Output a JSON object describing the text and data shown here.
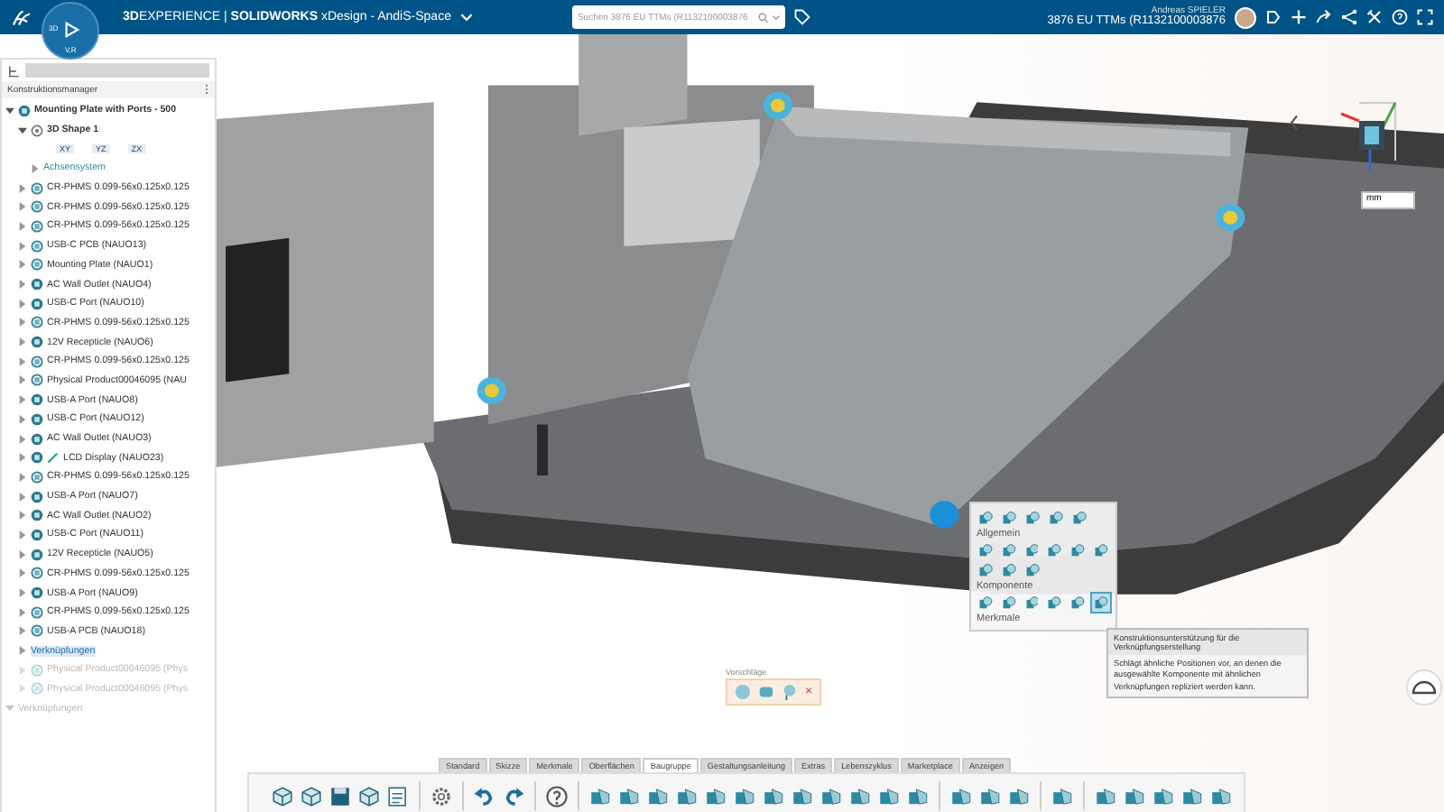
{
  "header": {
    "compass_labels": [
      "3D",
      "V,R"
    ],
    "title": "**3D**EXPERIENCE | **SOLIDWORKS** xDesign - AndiS-Space",
    "search": {
      "placeholder": "Suchen 3876 EU TTMs (R1132100003876"
    },
    "user": "Andreas SPIELER",
    "document": "3876 EU TTMs (R1132100003876"
  },
  "tree": {
    "title": "Konstruktionsmanager",
    "items": [
      {
        "label": "Mounting Plate with Ports - 500",
        "kind": "assembly",
        "expanded": true,
        "disabled": false,
        "children": [
          {
            "label": "3D Shape 1",
            "kind": "shape",
            "expanded": true,
            "disabled": false,
            "children": [
              {
                "kind": "planes",
                "planes": [
                  "XY",
                  "YZ",
                  "ZX"
                ]
              },
              {
                "label": "Achsensystem",
                "kind": "axis",
                "expanded": false,
                "disabled": false
              }
            ]
          },
          {
            "label": "CR-PHMS 0.099-56x0.125x0.125",
            "kind": "part",
            "expanded": false,
            "disabled": false
          },
          {
            "label": "CR-PHMS 0.099-56x0.125x0.125",
            "kind": "part",
            "expanded": false,
            "disabled": false
          },
          {
            "label": "CR-PHMS 0.099-56x0.125x0.125",
            "kind": "part",
            "expanded": false,
            "disabled": false
          },
          {
            "label": "USB-C PCB (NAUO13)",
            "kind": "part",
            "expanded": false,
            "disabled": false
          },
          {
            "label": "Mounting Plate (NAUO1)",
            "kind": "part",
            "expanded": false,
            "disabled": false
          },
          {
            "label": "AC Wall Outlet (NAUO4)",
            "kind": "product",
            "expanded": false,
            "disabled": false
          },
          {
            "label": "USB-C Port (NAUO10)",
            "kind": "product",
            "expanded": false,
            "disabled": false
          },
          {
            "label": "CR-PHMS 0.099-56x0.125x0.125",
            "kind": "part",
            "expanded": false,
            "disabled": false
          },
          {
            "label": "12V Recepticle (NAUO6)",
            "kind": "product",
            "expanded": false,
            "disabled": false
          },
          {
            "label": "CR-PHMS 0.099-56x0.125x0.125",
            "kind": "part",
            "expanded": false,
            "disabled": false
          },
          {
            "label": "Physical Product00046095 (NAU",
            "kind": "part",
            "expanded": false,
            "disabled": false
          },
          {
            "label": "USB-A Port (NAUO8)",
            "kind": "product",
            "expanded": false,
            "disabled": false
          },
          {
            "label": "USB-C Port (NAUO12)",
            "kind": "product",
            "expanded": false,
            "disabled": false
          },
          {
            "label": "AC Wall Outlet (NAUO3)",
            "kind": "product",
            "expanded": false,
            "disabled": false
          },
          {
            "label": "LCD Display (NAUO23)",
            "kind": "edited",
            "expanded": false,
            "disabled": false
          },
          {
            "label": "CR-PHMS 0.099-56x0.125x0.125",
            "kind": "part",
            "expanded": false,
            "disabled": false
          },
          {
            "label": "USB-A Port (NAUO7)",
            "kind": "product",
            "expanded": false,
            "disabled": false
          },
          {
            "label": "AC Wall Outlet (NAUO2)",
            "kind": "product",
            "expanded": false,
            "disabled": false
          },
          {
            "label": "USB-C Port (NAUO11)",
            "kind": "product",
            "expanded": false,
            "disabled": false
          },
          {
            "label": "12V Recepticle (NAUO5)",
            "kind": "product",
            "expanded": false,
            "disabled": false
          },
          {
            "label": "CR-PHMS 0.099-56x0.125x0.125",
            "kind": "part",
            "expanded": false,
            "disabled": false
          },
          {
            "label": "USB-A Port (NAUO9)",
            "kind": "product",
            "expanded": false,
            "disabled": false
          },
          {
            "label": "CR-PHMS 0.099-56x0.125x0.125",
            "kind": "part",
            "expanded": false,
            "disabled": false
          },
          {
            "label": "USB-A PCB (NAUO18)",
            "kind": "part",
            "expanded": false,
            "disabled": false
          },
          {
            "label": "Verknüpfungen",
            "kind": "ghost",
            "expanded": false,
            "disabled": false
          },
          {
            "label": "Physical Product00046095 (Phys",
            "kind": "part",
            "expanded": false,
            "disabled": true
          },
          {
            "label": "Physical Product00046095 (Phys",
            "kind": "part",
            "expanded": false,
            "disabled": true
          }
        ]
      },
      {
        "label": "Verknüpfungen",
        "kind": "section",
        "expanded": true,
        "disabled": true
      }
    ]
  },
  "context_menu": {
    "groups": [
      "Allgemein",
      "Komponente",
      "Merkmale"
    ],
    "tooltip": {
      "title": "Konstruktionsunterstützung für die Verknüpfungserstellung",
      "body": "Schlägt ähnliche Positionen vor, an denen die ausgewählte Komponente mit ähnlichen Verknüpfungen repliziert werden kann."
    }
  },
  "suggestions": {
    "title": "Vorschläge",
    "close": "×"
  },
  "units": "mm",
  "toolbar": {
    "tabs": [
      {
        "label": "Standard",
        "selected": false
      },
      {
        "label": "Skizze",
        "selected": false
      },
      {
        "label": "Merkmale",
        "selected": false
      },
      {
        "label": "Oberflächen",
        "selected": false
      },
      {
        "label": "Baugruppe",
        "selected": true
      },
      {
        "label": "Gestaltungsanleitung",
        "selected": false
      },
      {
        "label": "Extras",
        "selected": false
      },
      {
        "label": "Lebenszyklus",
        "selected": false
      },
      {
        "label": "Marketplace",
        "selected": false
      },
      {
        "label": "Anzeigen",
        "selected": false
      }
    ]
  }
}
